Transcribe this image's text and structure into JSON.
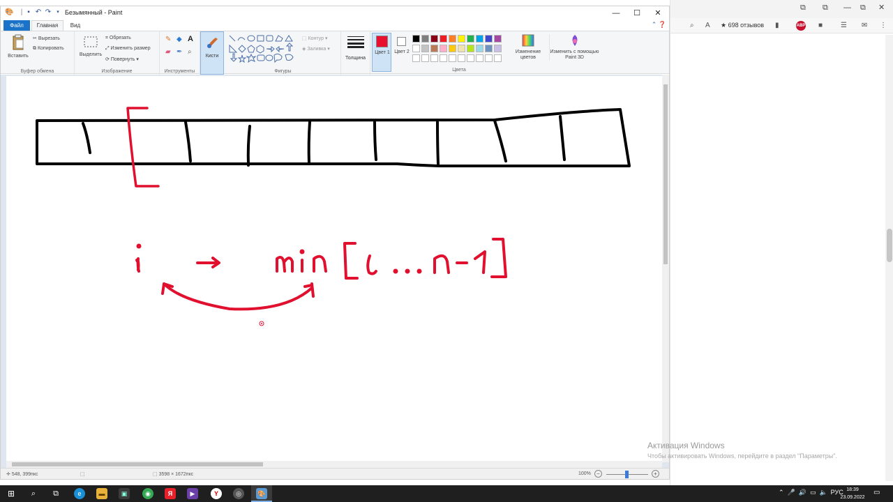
{
  "window": {
    "title": "Безымянный - Paint",
    "minimize": "—",
    "maximize": "☐",
    "close": "✕"
  },
  "tabs": {
    "file": "Файл",
    "home": "Главная",
    "view": "Вид"
  },
  "ribbon": {
    "clipboard": {
      "label": "Буфер обмена",
      "paste": "Вставить",
      "cut": "Вырезать",
      "copy": "Копировать"
    },
    "image": {
      "label": "Изображение",
      "select": "Выделить",
      "crop": "Обрезать",
      "resize": "Изменить размер",
      "rotate": "Повернуть"
    },
    "tools": {
      "label": "Инструменты"
    },
    "brushes": {
      "label": "Кисти"
    },
    "shapes": {
      "label": "Фигуры",
      "outline": "Контур",
      "fill": "Заливка"
    },
    "size": {
      "label": "Толщина"
    },
    "color1": {
      "label": "Цвет 1",
      "value": "#e8102e"
    },
    "color2": {
      "label": "Цвет 2",
      "value": "#ffffff"
    },
    "colors": {
      "label": "Цвета",
      "edit": "Изменение цветов"
    },
    "paint3d": {
      "label": "Изменить с помощью Paint 3D"
    }
  },
  "palette": [
    "#000000",
    "#7f7f7f",
    "#880015",
    "#ed1c24",
    "#ff7f27",
    "#fff200",
    "#22b14c",
    "#00a2e8",
    "#3f48cc",
    "#a349a4",
    "#ffffff",
    "#c3c3c3",
    "#b97a57",
    "#ffaec9",
    "#ffc90e",
    "#efe4b0",
    "#b5e61d",
    "#99d9ea",
    "#7092be",
    "#c8bfe7",
    "#ffffff",
    "#ffffff",
    "#ffffff",
    "#ffffff",
    "#ffffff",
    "#ffffff",
    "#ffffff",
    "#ffffff",
    "#ffffff",
    "#ffffff"
  ],
  "status": {
    "position": "548, 399пкс",
    "canvas_size": "3598 × 1672пкс",
    "zoom": "100%"
  },
  "browser": {
    "reviews": "★ 698 отзывов",
    "abp": "ABP"
  },
  "activation": {
    "title": "Активация Windows",
    "subtitle": "Чтобы активировать Windows, перейдите в раздел \"Параметры\"."
  },
  "taskbar": {
    "language": "РУС",
    "time": "18:39",
    "date": "23.09.2022"
  },
  "drawing": {
    "formula": "i → min [i … n-1]",
    "stroke_black": "#000000",
    "stroke_red": "#e0102e"
  }
}
